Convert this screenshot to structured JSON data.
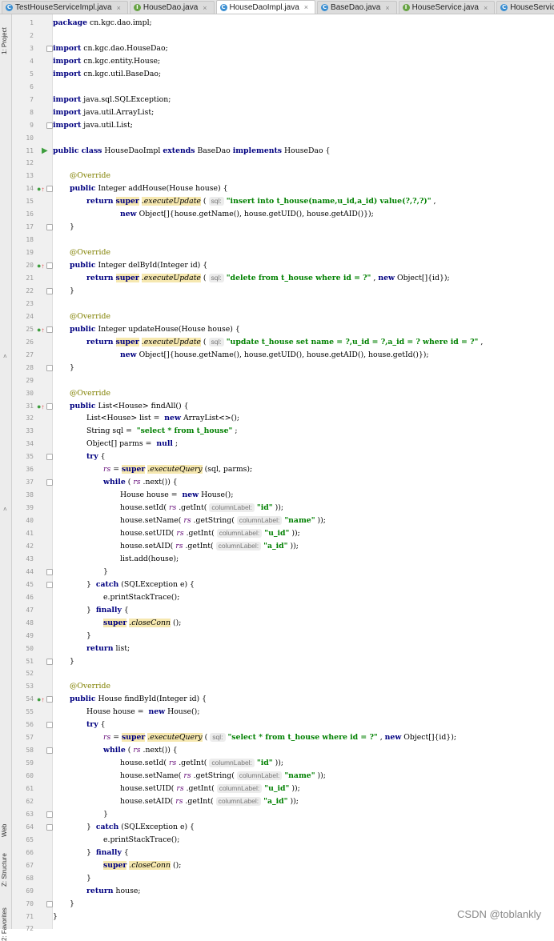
{
  "tabs": [
    {
      "label": "TestHouseServiceImpl.java",
      "icon": "class-icon",
      "active": false
    },
    {
      "label": "HouseDao.java",
      "icon": "interface-icon",
      "active": false
    },
    {
      "label": "HouseDaoImpl.java",
      "icon": "class-icon",
      "active": true
    },
    {
      "label": "BaseDao.java",
      "icon": "class-icon",
      "active": false
    },
    {
      "label": "HouseService.java",
      "icon": "interface-icon",
      "active": false
    },
    {
      "label": "HouseServiceImpl.java",
      "icon": "class-icon",
      "active": false
    }
  ],
  "side_panels": {
    "project": "1: Project",
    "web": "Web",
    "structure": "Z: Structure",
    "favorites": "2: Favorites"
  },
  "watermark": "CSDN @toblankly",
  "code_lines": [
    {
      "n": "1",
      "indent": 0,
      "tokens": [
        [
          "kw",
          "package"
        ],
        [
          "",
          "cn.kgc.dao.impl;"
        ]
      ]
    },
    {
      "n": "2",
      "indent": 0,
      "tokens": []
    },
    {
      "n": "3",
      "indent": 0,
      "tokens": [
        [
          "kw",
          "import"
        ],
        [
          "",
          "cn.kgc.dao.HouseDao;"
        ]
      ]
    },
    {
      "n": "4",
      "indent": 0,
      "tokens": [
        [
          "kw",
          "import"
        ],
        [
          "",
          "cn.kgc.entity.House;"
        ]
      ]
    },
    {
      "n": "5",
      "indent": 0,
      "tokens": [
        [
          "kw",
          "import"
        ],
        [
          "",
          "cn.kgc.util.BaseDao;"
        ]
      ]
    },
    {
      "n": "6",
      "indent": 0,
      "tokens": []
    },
    {
      "n": "7",
      "indent": 0,
      "tokens": [
        [
          "kw",
          "import"
        ],
        [
          "",
          "java.sql.SQLException;"
        ]
      ]
    },
    {
      "n": "8",
      "indent": 0,
      "tokens": [
        [
          "kw",
          "import"
        ],
        [
          "",
          "java.util.ArrayList;"
        ]
      ]
    },
    {
      "n": "9",
      "indent": 0,
      "tokens": [
        [
          "kw",
          "import"
        ],
        [
          "",
          "java.util.List;"
        ]
      ]
    },
    {
      "n": "10",
      "indent": 0,
      "tokens": []
    },
    {
      "n": "11",
      "indent": 0,
      "tokens": [
        [
          "kw",
          "public class"
        ],
        [
          "",
          "HouseDaoImpl"
        ],
        [
          "kw",
          "extends"
        ],
        [
          "",
          "BaseDao"
        ],
        [
          "kw",
          "implements"
        ],
        [
          "",
          "HouseDao {"
        ]
      ]
    },
    {
      "n": "12",
      "indent": 0,
      "tokens": []
    },
    {
      "n": "13",
      "indent": 1,
      "tokens": [
        [
          "ann",
          "@Override"
        ]
      ]
    },
    {
      "n": "14",
      "indent": 1,
      "tokens": [
        [
          "kw",
          "public"
        ],
        [
          "",
          "Integer addHouse(House house) {"
        ]
      ]
    },
    {
      "n": "15",
      "indent": 2,
      "tokens": [
        [
          "kw",
          "return"
        ],
        [
          "hl kw",
          "super"
        ],
        [
          "hl mth",
          ".executeUpdate"
        ],
        [
          "",
          "("
        ],
        [
          "hint",
          "sql:"
        ],
        [
          "str",
          "\"insert into t_house(name,u_id,a_id) value(?,?,?)\""
        ],
        [
          "",
          ","
        ]
      ]
    },
    {
      "n": "16",
      "indent": 4,
      "tokens": [
        [
          "kw",
          "new"
        ],
        [
          "",
          "Object[]{house.getName(), house.getUID(), house.getAID()});"
        ]
      ]
    },
    {
      "n": "17",
      "indent": 1,
      "tokens": [
        [
          "",
          "}"
        ]
      ]
    },
    {
      "n": "18",
      "indent": 0,
      "tokens": []
    },
    {
      "n": "19",
      "indent": 1,
      "tokens": [
        [
          "ann",
          "@Override"
        ]
      ]
    },
    {
      "n": "20",
      "indent": 1,
      "tokens": [
        [
          "kw",
          "public"
        ],
        [
          "",
          "Integer delById(Integer id) {"
        ]
      ]
    },
    {
      "n": "21",
      "indent": 2,
      "tokens": [
        [
          "kw",
          "return"
        ],
        [
          "hl kw",
          "super"
        ],
        [
          "hl mth",
          ".executeUpdate"
        ],
        [
          "",
          "("
        ],
        [
          "hint",
          "sql:"
        ],
        [
          "str",
          "\"delete from t_house where id = ?\""
        ],
        [
          "",
          ","
        ],
        [
          "kw",
          "new"
        ],
        [
          "",
          "Object[]{id});"
        ]
      ]
    },
    {
      "n": "22",
      "indent": 1,
      "tokens": [
        [
          "",
          "}"
        ]
      ]
    },
    {
      "n": "23",
      "indent": 0,
      "tokens": []
    },
    {
      "n": "24",
      "indent": 1,
      "tokens": [
        [
          "ann",
          "@Override"
        ]
      ]
    },
    {
      "n": "25",
      "indent": 1,
      "tokens": [
        [
          "kw",
          "public"
        ],
        [
          "",
          "Integer updateHouse(House house) {"
        ]
      ]
    },
    {
      "n": "26",
      "indent": 2,
      "tokens": [
        [
          "kw",
          "return"
        ],
        [
          "hl kw",
          "super"
        ],
        [
          "hl mth",
          ".executeUpdate"
        ],
        [
          "",
          "("
        ],
        [
          "hint",
          "sql:"
        ],
        [
          "str",
          "\"update t_house set name = ?,u_id = ?,a_id = ? where id = ?\""
        ],
        [
          "",
          ","
        ]
      ]
    },
    {
      "n": "27",
      "indent": 4,
      "tokens": [
        [
          "kw",
          "new"
        ],
        [
          "",
          "Object[]{house.getName(), house.getUID(), house.getAID(), house.getId()});"
        ]
      ]
    },
    {
      "n": "28",
      "indent": 1,
      "tokens": [
        [
          "",
          "}"
        ]
      ]
    },
    {
      "n": "29",
      "indent": 0,
      "tokens": []
    },
    {
      "n": "30",
      "indent": 1,
      "tokens": [
        [
          "ann",
          "@Override"
        ]
      ]
    },
    {
      "n": "31",
      "indent": 1,
      "tokens": [
        [
          "kw",
          "public"
        ],
        [
          "",
          "List<House> findAll() {"
        ]
      ]
    },
    {
      "n": "32",
      "indent": 2,
      "tokens": [
        [
          "",
          "List<House> list = "
        ],
        [
          "kw",
          "new"
        ],
        [
          "",
          "ArrayList<>();"
        ]
      ]
    },
    {
      "n": "33",
      "indent": 2,
      "tokens": [
        [
          "",
          "String sql = "
        ],
        [
          "str",
          "\"select * from t_house\""
        ],
        [
          "",
          ";"
        ]
      ]
    },
    {
      "n": "34",
      "indent": 2,
      "tokens": [
        [
          "",
          "Object[] parms = "
        ],
        [
          "kw",
          "null"
        ],
        [
          "",
          ";"
        ]
      ]
    },
    {
      "n": "35",
      "indent": 2,
      "tokens": [
        [
          "kw",
          "try"
        ],
        [
          "",
          "{"
        ]
      ]
    },
    {
      "n": "36",
      "indent": 3,
      "tokens": [
        [
          "fld",
          "rs"
        ],
        [
          "",
          "="
        ],
        [
          "hl kw",
          "super"
        ],
        [
          "hl mth",
          ".executeQuery"
        ],
        [
          "",
          "(sql, parms);"
        ]
      ]
    },
    {
      "n": "37",
      "indent": 3,
      "tokens": [
        [
          "kw",
          "while"
        ],
        [
          "",
          "("
        ],
        [
          "fld",
          "rs"
        ],
        [
          "",
          ".next()) {"
        ]
      ]
    },
    {
      "n": "38",
      "indent": 4,
      "tokens": [
        [
          "",
          "House house = "
        ],
        [
          "kw",
          "new"
        ],
        [
          "",
          "House();"
        ]
      ]
    },
    {
      "n": "39",
      "indent": 4,
      "tokens": [
        [
          "",
          "house.setId("
        ],
        [
          "fld",
          "rs"
        ],
        [
          "",
          ".getInt("
        ],
        [
          "hint",
          "columnLabel:"
        ],
        [
          "str",
          "\"id\""
        ],
        [
          "",
          "));"
        ]
      ]
    },
    {
      "n": "40",
      "indent": 4,
      "tokens": [
        [
          "",
          "house.setName("
        ],
        [
          "fld",
          "rs"
        ],
        [
          "",
          ".getString("
        ],
        [
          "hint",
          "columnLabel:"
        ],
        [
          "str",
          "\"name\""
        ],
        [
          "",
          "));"
        ]
      ]
    },
    {
      "n": "41",
      "indent": 4,
      "tokens": [
        [
          "",
          "house.setUID("
        ],
        [
          "fld",
          "rs"
        ],
        [
          "",
          ".getInt("
        ],
        [
          "hint",
          "columnLabel:"
        ],
        [
          "str",
          "\"u_id\""
        ],
        [
          "",
          "));"
        ]
      ]
    },
    {
      "n": "42",
      "indent": 4,
      "tokens": [
        [
          "",
          "house.setAID("
        ],
        [
          "fld",
          "rs"
        ],
        [
          "",
          ".getInt("
        ],
        [
          "hint",
          "columnLabel:"
        ],
        [
          "str",
          "\"a_id\""
        ],
        [
          "",
          "));"
        ]
      ]
    },
    {
      "n": "43",
      "indent": 4,
      "tokens": [
        [
          "",
          "list.add(house);"
        ]
      ]
    },
    {
      "n": "44",
      "indent": 3,
      "tokens": [
        [
          "",
          "}"
        ]
      ]
    },
    {
      "n": "45",
      "indent": 2,
      "tokens": [
        [
          "",
          "} "
        ],
        [
          "kw",
          "catch"
        ],
        [
          "",
          "(SQLException e) {"
        ]
      ]
    },
    {
      "n": "46",
      "indent": 3,
      "tokens": [
        [
          "",
          "e.printStackTrace();"
        ]
      ]
    },
    {
      "n": "47",
      "indent": 2,
      "tokens": [
        [
          "",
          "} "
        ],
        [
          "kw",
          "finally"
        ],
        [
          "",
          "{"
        ]
      ]
    },
    {
      "n": "48",
      "indent": 3,
      "tokens": [
        [
          "hl kw",
          "super"
        ],
        [
          "hl mth",
          ".closeConn"
        ],
        [
          "",
          "();"
        ]
      ]
    },
    {
      "n": "49",
      "indent": 2,
      "tokens": [
        [
          "",
          "}"
        ]
      ]
    },
    {
      "n": "50",
      "indent": 2,
      "tokens": [
        [
          "kw",
          "return"
        ],
        [
          "",
          "list;"
        ]
      ]
    },
    {
      "n": "51",
      "indent": 1,
      "tokens": [
        [
          "",
          "}"
        ]
      ]
    },
    {
      "n": "52",
      "indent": 0,
      "tokens": []
    },
    {
      "n": "53",
      "indent": 1,
      "tokens": [
        [
          "ann",
          "@Override"
        ]
      ]
    },
    {
      "n": "54",
      "indent": 1,
      "tokens": [
        [
          "kw",
          "public"
        ],
        [
          "",
          "House findById(Integer id) {"
        ]
      ]
    },
    {
      "n": "55",
      "indent": 2,
      "tokens": [
        [
          "",
          "House house = "
        ],
        [
          "kw",
          "new"
        ],
        [
          "",
          "House();"
        ]
      ]
    },
    {
      "n": "56",
      "indent": 2,
      "tokens": [
        [
          "kw",
          "try"
        ],
        [
          "",
          "{"
        ]
      ]
    },
    {
      "n": "57",
      "indent": 3,
      "tokens": [
        [
          "fld",
          "rs"
        ],
        [
          "",
          "="
        ],
        [
          "hl kw",
          "super"
        ],
        [
          "hl mth",
          ".executeQuery"
        ],
        [
          "",
          "("
        ],
        [
          "hint",
          "sql:"
        ],
        [
          "str",
          "\"select * from t_house where id = ?\""
        ],
        [
          "",
          ","
        ],
        [
          "kw",
          "new"
        ],
        [
          "",
          "Object[]{id});"
        ]
      ]
    },
    {
      "n": "58",
      "indent": 3,
      "tokens": [
        [
          "kw",
          "while"
        ],
        [
          "",
          "("
        ],
        [
          "fld",
          "rs"
        ],
        [
          "",
          ".next()) {"
        ]
      ]
    },
    {
      "n": "59",
      "indent": 4,
      "tokens": [
        [
          "",
          "house.setId("
        ],
        [
          "fld",
          "rs"
        ],
        [
          "",
          ".getInt("
        ],
        [
          "hint",
          "columnLabel:"
        ],
        [
          "str",
          "\"id\""
        ],
        [
          "",
          "));"
        ]
      ]
    },
    {
      "n": "60",
      "indent": 4,
      "tokens": [
        [
          "",
          "house.setName("
        ],
        [
          "fld",
          "rs"
        ],
        [
          "",
          ".getString("
        ],
        [
          "hint",
          "columnLabel:"
        ],
        [
          "str",
          "\"name\""
        ],
        [
          "",
          "));"
        ]
      ]
    },
    {
      "n": "61",
      "indent": 4,
      "tokens": [
        [
          "",
          "house.setUID("
        ],
        [
          "fld",
          "rs"
        ],
        [
          "",
          ".getInt("
        ],
        [
          "hint",
          "columnLabel:"
        ],
        [
          "str",
          "\"u_id\""
        ],
        [
          "",
          "));"
        ]
      ]
    },
    {
      "n": "62",
      "indent": 4,
      "tokens": [
        [
          "",
          "house.setAID("
        ],
        [
          "fld",
          "rs"
        ],
        [
          "",
          ".getInt("
        ],
        [
          "hint",
          "columnLabel:"
        ],
        [
          "str",
          "\"a_id\""
        ],
        [
          "",
          "));"
        ]
      ]
    },
    {
      "n": "63",
      "indent": 3,
      "tokens": [
        [
          "",
          "}"
        ]
      ]
    },
    {
      "n": "64",
      "indent": 2,
      "tokens": [
        [
          "",
          "} "
        ],
        [
          "kw",
          "catch"
        ],
        [
          "",
          "(SQLException e) {"
        ]
      ]
    },
    {
      "n": "65",
      "indent": 3,
      "tokens": [
        [
          "",
          "e.printStackTrace();"
        ]
      ]
    },
    {
      "n": "66",
      "indent": 2,
      "tokens": [
        [
          "",
          "} "
        ],
        [
          "kw",
          "finally"
        ],
        [
          "",
          "{"
        ]
      ]
    },
    {
      "n": "67",
      "indent": 3,
      "tokens": [
        [
          "hl kw",
          "super"
        ],
        [
          "hl mth",
          ".closeConn"
        ],
        [
          "",
          "();"
        ]
      ]
    },
    {
      "n": "68",
      "indent": 2,
      "tokens": [
        [
          "",
          "}"
        ]
      ]
    },
    {
      "n": "69",
      "indent": 2,
      "tokens": [
        [
          "kw",
          "return"
        ],
        [
          "",
          "house;"
        ]
      ]
    },
    {
      "n": "70",
      "indent": 1,
      "tokens": [
        [
          "",
          "}"
        ]
      ]
    },
    {
      "n": "71",
      "indent": 0,
      "tokens": [
        [
          "",
          "}"
        ]
      ]
    },
    {
      "n": "72",
      "indent": 0,
      "tokens": []
    }
  ],
  "gutter_markers": {
    "run": [
      "11"
    ],
    "override": [
      "14",
      "20",
      "25",
      "31",
      "54"
    ]
  }
}
